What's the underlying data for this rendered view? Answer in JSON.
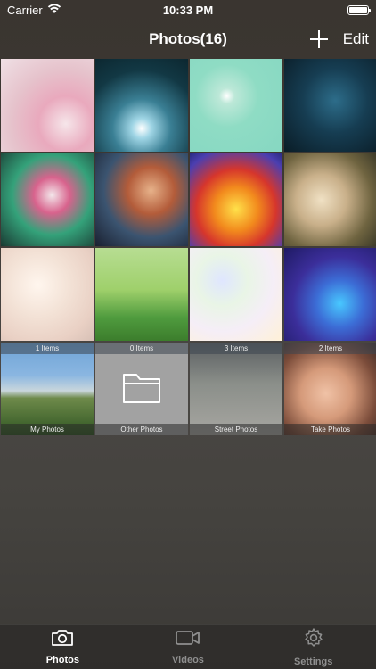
{
  "status": {
    "carrier": "Carrier",
    "time": "10:33 PM"
  },
  "nav": {
    "title": "Photos(16)",
    "edit_label": "Edit"
  },
  "albums": [
    {
      "count": "1 Items",
      "name": "My Photos"
    },
    {
      "count": "0 Items",
      "name": "Other Photos"
    },
    {
      "count": "3 Items",
      "name": "Street Photos"
    },
    {
      "count": "2 Items",
      "name": "Take Photos"
    }
  ],
  "tabs": [
    {
      "label": "Photos",
      "icon": "camera-icon",
      "active": true
    },
    {
      "label": "Videos",
      "icon": "video-icon",
      "active": false
    },
    {
      "label": "Settings",
      "icon": "gear-icon",
      "active": false
    }
  ]
}
